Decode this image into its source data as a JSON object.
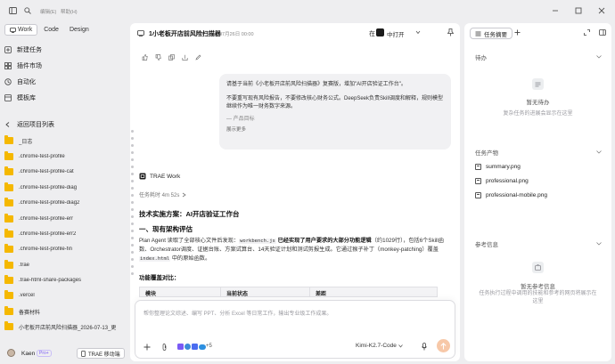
{
  "menu": {
    "edit": "编辑(E)",
    "help": "帮助(H)"
  },
  "sidebar": {
    "tabs": [
      {
        "label": "Work",
        "active": true
      },
      {
        "label": "Code",
        "active": false
      },
      {
        "label": "Design",
        "active": false
      }
    ],
    "nav": [
      {
        "label": "新建任务",
        "icon": "new-task-icon"
      },
      {
        "label": "插件市场",
        "icon": "plugin-market-icon"
      },
      {
        "label": "自动化",
        "icon": "automation-icon"
      },
      {
        "label": "模板库",
        "icon": "template-icon"
      }
    ],
    "back_label": "返回项目列表",
    "folders": [
      "_日志",
      ".chrome-test-profile",
      ".chrome-test-profile-cat",
      ".chrome-test-profile-diag",
      ".chrome-test-profile-diag2",
      ".chrome-test-profile-err",
      ".chrome-test-profile-err2",
      ".chrome-test-profile-fin",
      ".trae",
      ".trae-html-share-packages",
      ".vercel",
      "备赛材料",
      "小老板开店前风险扫描器_2026-07-13_更"
    ],
    "user": {
      "name": "Kaen",
      "badge": "Pro+",
      "mobile_label": "TRAE 移动端"
    }
  },
  "main": {
    "title": "1小老板开店前风险扫描器",
    "date": "07月26日 00:00",
    "open_label": "中打开",
    "user_message": {
      "p1": "请基于当前《小老板开店前风险扫描器》复赛版，增加\"AI开店验证工作台\"。",
      "p2": "不要重写现有风险报告，不要修改核心财务公式。DeepSeek负责Skill调度和解释，规则模型继续作为唯一财务数字来源。",
      "p3": "— 产品目标",
      "more": "展示更多"
    },
    "agent": {
      "name": "TRAE Work",
      "elapsed": "任务耗时 4m 52s"
    },
    "response": {
      "h1": "技术实施方案：AI开店验证工作台",
      "h2": "一、现有架构评估",
      "p_a": "Plan Agent 读取了全部核心文件后发现：",
      "code1": "workbench.js",
      "p_b": " 已经实现了用户要求的大部分功能逻辑",
      "p_c": "（约1029行），包括6个Skill函数、Orchestrator调度、证据台账、方案试算台、14天验证计划和测试剪报生成。它通过猴子补丁（monkey-patching）覆盖 ",
      "code2": "index.html",
      "p_d": " 中的原始函数。",
      "h3": "功能覆盖对比：",
      "table_headers": [
        "模块",
        "当前状态",
        "差距"
      ]
    },
    "input": {
      "placeholder": "帮你整理论文综述、编写 PPT、分析 Excel 等日常工作，输出专业级工作成果。",
      "plus_count": "+5",
      "model": "Kimi-K2.7-Code"
    }
  },
  "right": {
    "tab_label": "任务摘要",
    "todo": {
      "title": "待办",
      "empty_title": "暂无待办",
      "empty_desc": "复杂任务的进展会显示在这里"
    },
    "outputs": {
      "title": "任务产物",
      "files": [
        "summary.png",
        "professional.png",
        "professional-mobile.png"
      ]
    },
    "refs": {
      "title": "参考信息",
      "empty_title": "暂无参考信息",
      "empty_desc": "任务执行过程中调用的技能和参考的网页将展示在这里"
    }
  },
  "colors": {
    "folder": "#f5b800",
    "accent_send": "#f7c8a8",
    "active_border": "#c9c9cf"
  }
}
